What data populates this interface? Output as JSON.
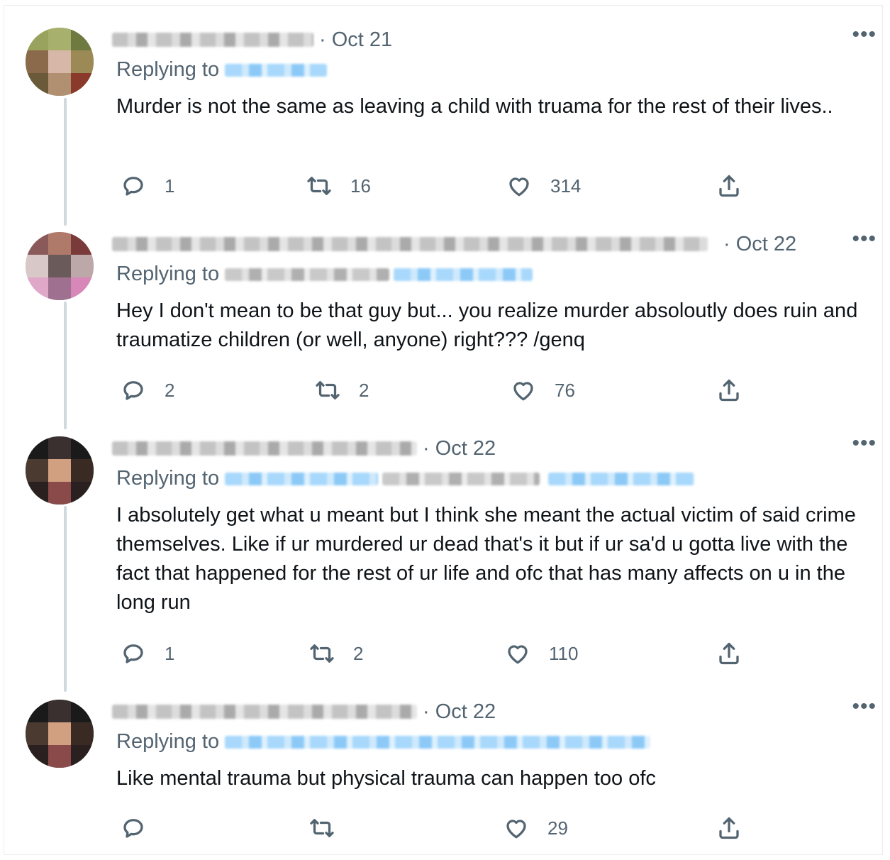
{
  "tweets": [
    {
      "date": "· Oct 21",
      "replying_label": "Replying to",
      "text": "Murder is not the same as leaving a child with truama for the rest of their lives..",
      "replies": "1",
      "retweets": "16",
      "likes": "314"
    },
    {
      "date": "· Oct 22",
      "replying_label": "Replying to",
      "text": "Hey I don't mean to be that guy but... you realize murder absoloutly does ruin and traumatize children (or well, anyone) right??? /genq",
      "replies": "2",
      "retweets": "2",
      "likes": "76"
    },
    {
      "date": "· Oct 22",
      "replying_label": "Replying to",
      "text": "I absolutely get what u meant but I think she meant the actual victim of said crime themselves. Like if ur murdered ur dead that's it but if ur sa'd u gotta live with the fact that happened for the rest of ur life and ofc that has many affects on u in the long run",
      "replies": "1",
      "retweets": "2",
      "likes": "110"
    },
    {
      "date": "· Oct 22",
      "replying_label": "Replying to",
      "text": "Like mental trauma but physical trauma can happen too ofc",
      "replies": "",
      "retweets": "",
      "likes": "29"
    }
  ],
  "more_glyph": "•••",
  "icons": [
    "reply-icon",
    "retweet-icon",
    "like-icon",
    "share-icon",
    "more-icon"
  ],
  "colors": {
    "text": "#0f1419",
    "muted": "#536471",
    "link": "#1d9bf0",
    "thread_line": "#cfd9de"
  }
}
